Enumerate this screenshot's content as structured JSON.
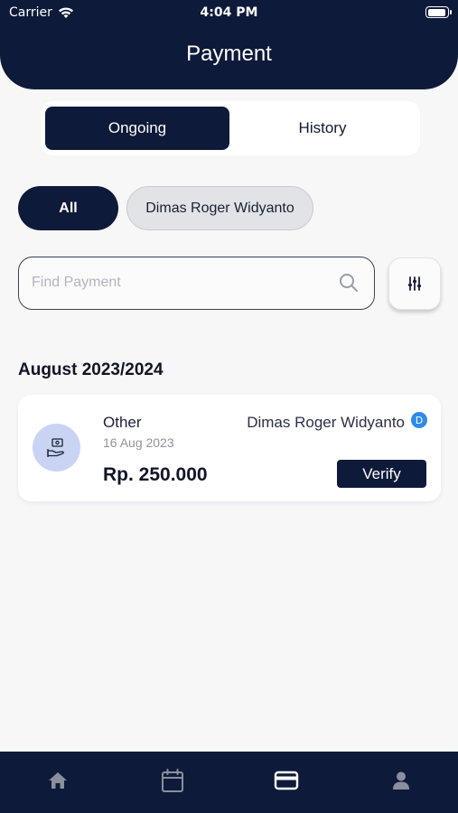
{
  "status_bar": {
    "carrier": "Carrier",
    "time": "4:04 PM"
  },
  "header": {
    "title": "Payment"
  },
  "tabs": [
    {
      "label": "Ongoing",
      "active": true
    },
    {
      "label": "History",
      "active": false
    }
  ],
  "filters": {
    "all_label": "All",
    "person_label": "Dimas Roger Widyanto"
  },
  "search": {
    "placeholder": "Find Payment"
  },
  "section": {
    "title": "August 2023/2024"
  },
  "payments": [
    {
      "category": "Other",
      "date": "16 Aug 2023",
      "amount": "Rp. 250.000",
      "name": "Dimas Roger Widyanto",
      "badge": "D",
      "action_label": "Verify"
    }
  ],
  "bottom_nav": [
    {
      "icon": "home-icon",
      "active": false
    },
    {
      "icon": "calendar-icon",
      "active": false
    },
    {
      "icon": "card-icon",
      "active": true
    },
    {
      "icon": "profile-icon",
      "active": false
    }
  ],
  "colors": {
    "primary": "#0e1a3a",
    "background": "#f7f7f8",
    "icon_bg": "#c9d4f5",
    "badge": "#2f8ae8"
  }
}
